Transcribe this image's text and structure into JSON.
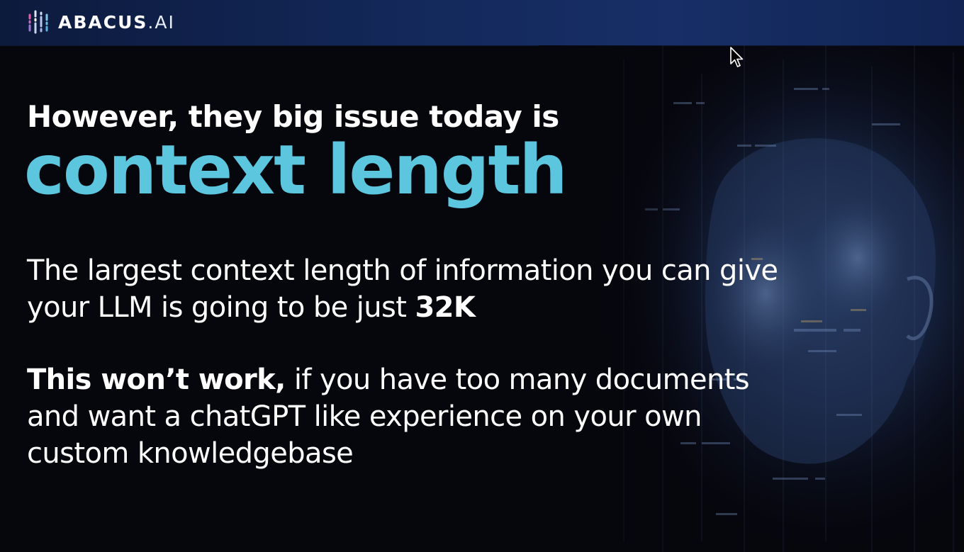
{
  "brand": {
    "name_bold": "ABACUS",
    "name_thin": ".AI",
    "logo_icon": "abacus-bars-icon"
  },
  "slide": {
    "headline": "However, they big issue today is",
    "highlight": "context length",
    "paragraph1": {
      "text": "The largest context length of information you can give your LLM is going to be just ",
      "emphasis": "32K"
    },
    "paragraph2": {
      "emphasis": "This won’t work,",
      "text": " if you have too many documents and want a chatGPT like experience on your own custom knowledgebase"
    }
  },
  "colors": {
    "highlight": "#5cc6de",
    "header_bg": "#14295c",
    "slide_bg": "#06060d"
  },
  "cursor_icon": "arrow-pointer-icon"
}
